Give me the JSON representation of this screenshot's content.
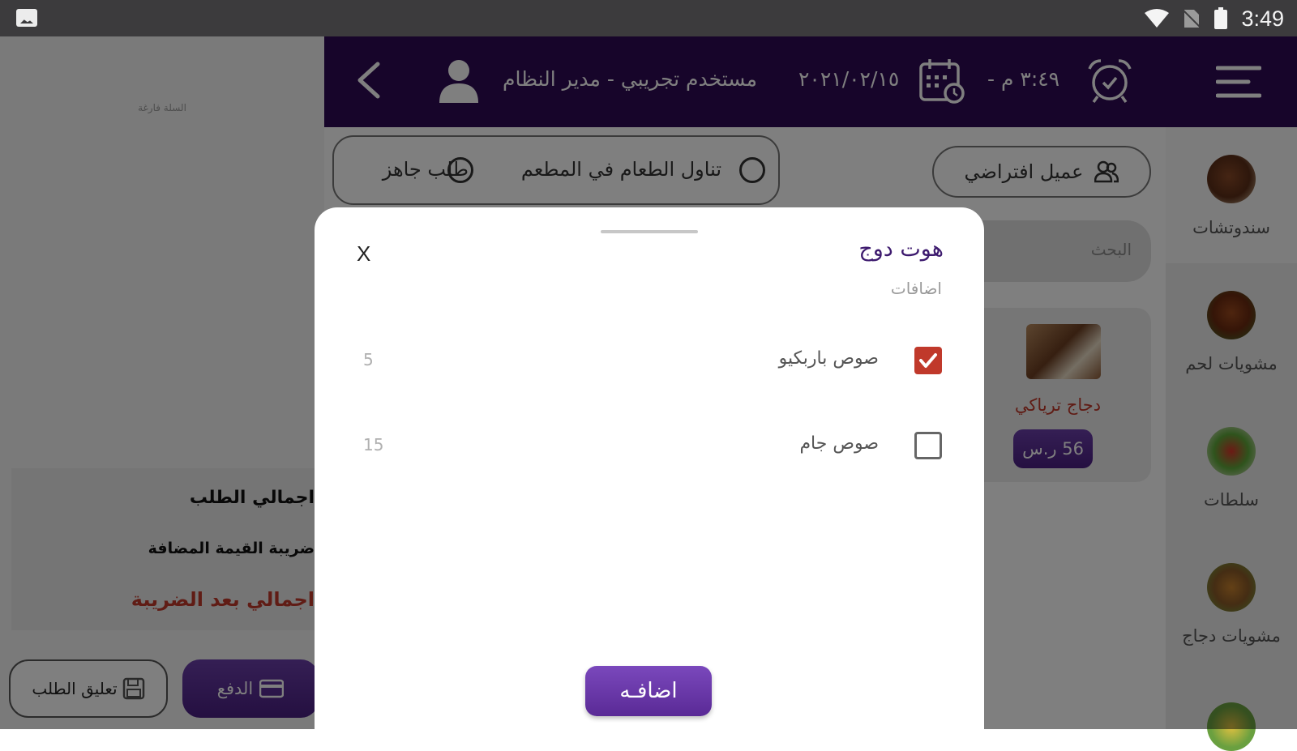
{
  "status_bar": {
    "time": "3:49"
  },
  "header": {
    "user": "مستخدم تجريبي - مدير النظام",
    "date": "٢٠٢١/٠٢/١٥",
    "time": "٣:٤٩ م  -"
  },
  "left_panel": {
    "empty_cart": "السلة فارغة",
    "totals": {
      "order_total": "اجمالي الطلب",
      "vat": "ضريبة القيمة المضافة",
      "total_after_tax": "اجمالي بعد الضريبة"
    },
    "hold_label": "تعليق الطلب",
    "pay_label": "الدفع"
  },
  "order_type": {
    "dine_in": "تناول الطعام في المطعم",
    "ready_order": "طلب جاهز"
  },
  "customer_button": "عميل افتراضي",
  "search_placeholder": "البحث",
  "product": {
    "name": "دجاج ترياكي",
    "price": "56 ر.س"
  },
  "categories": [
    {
      "label": "سندوتشات",
      "active": true
    },
    {
      "label": "مشويات لحم",
      "active": false
    },
    {
      "label": "سلطات",
      "active": false
    },
    {
      "label": "مشويات دجاج",
      "active": false
    }
  ],
  "dialog": {
    "close": "X",
    "title": "هوت دوج",
    "subtitle": "اضافات",
    "options": [
      {
        "label": "صوص باربكيو",
        "price": "5",
        "checked": true
      },
      {
        "label": "صوص جام",
        "price": "15",
        "checked": false
      }
    ],
    "add_label": "اضافـه"
  },
  "colors": {
    "header_bg": "#2e0b55",
    "accent_purple": "#5a2a96",
    "danger_red": "#c0392b"
  }
}
